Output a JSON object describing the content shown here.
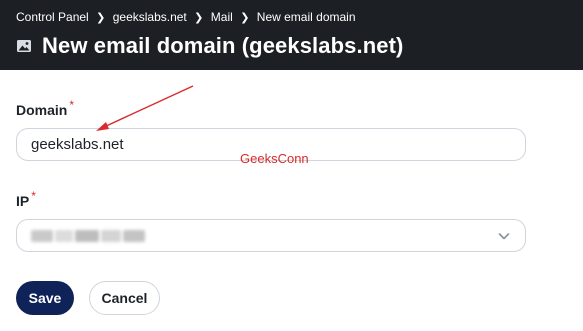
{
  "header": {
    "breadcrumb": [
      "Control Panel",
      "geekslabs.net",
      "Mail",
      "New email domain"
    ],
    "title": "New email domain (geekslabs.net)",
    "title_icon": "image-icon"
  },
  "form": {
    "domain": {
      "label": "Domain",
      "required_mark": "*",
      "value": "geekslabs.net"
    },
    "ip": {
      "label": "IP",
      "required_mark": "*",
      "selected_value_blurred": true,
      "dropdown_icon": "chevron-down-icon"
    }
  },
  "actions": {
    "save_label": "Save",
    "cancel_label": "Cancel"
  },
  "annotation": {
    "watermark_text": "GeeksConn",
    "arrow_color": "#d92b2b"
  },
  "colors": {
    "header_bg": "#1c1f24",
    "primary_button": "#0f2358",
    "required": "#d92b2b"
  }
}
